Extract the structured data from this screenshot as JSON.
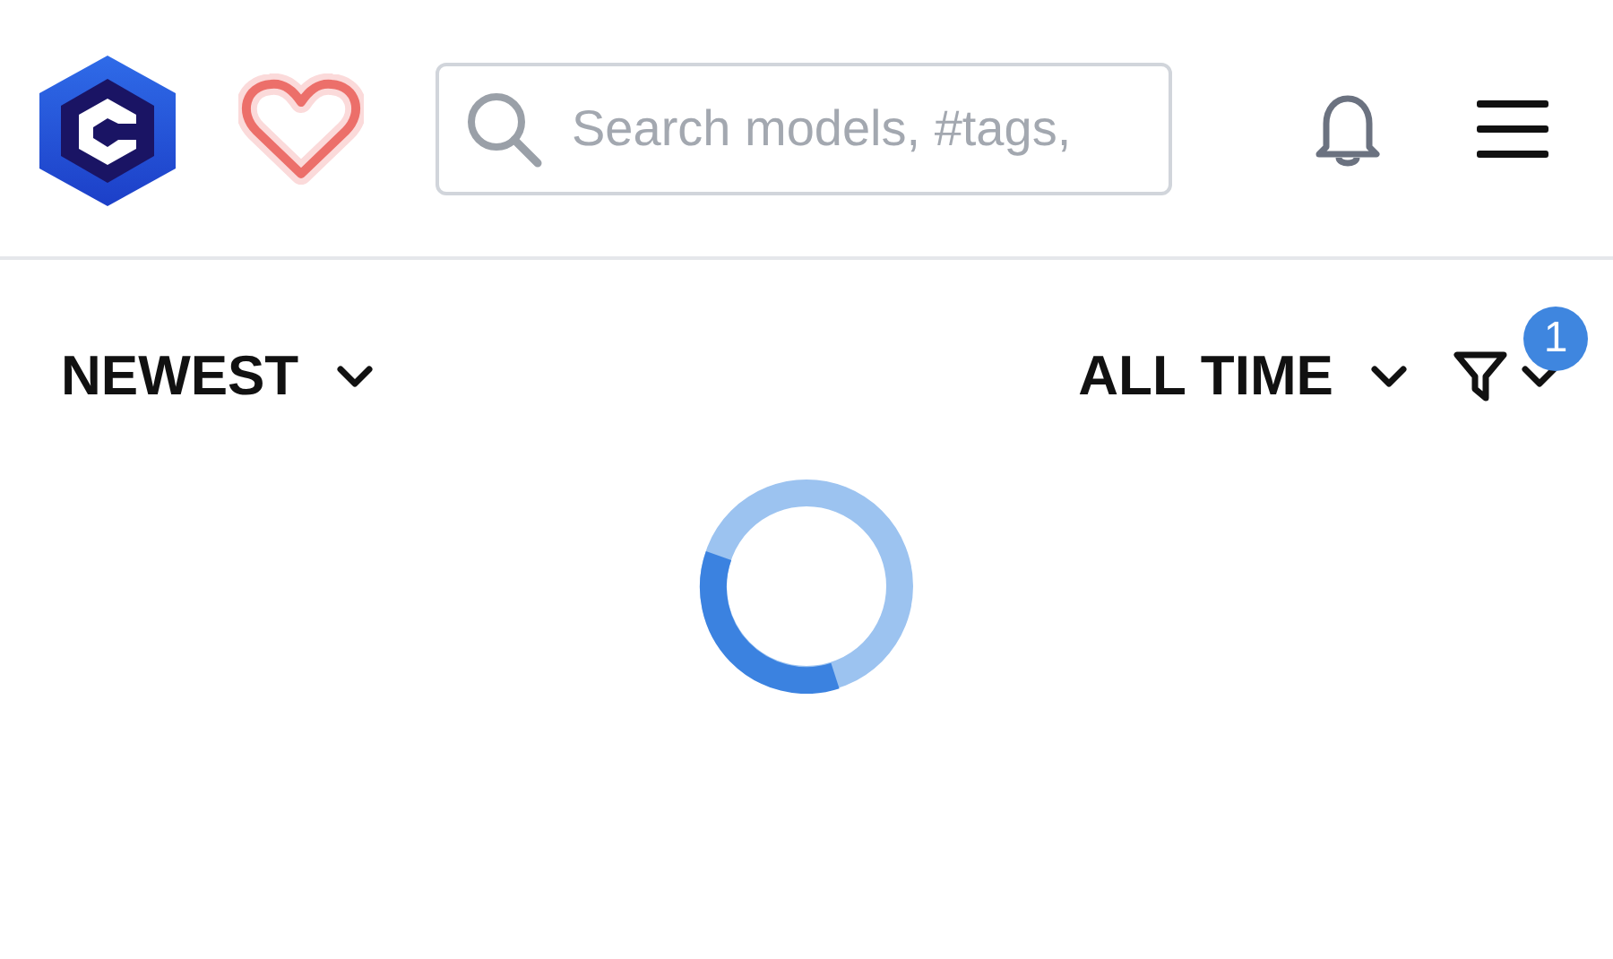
{
  "header": {
    "search": {
      "placeholder": "Search models, #tags,"
    }
  },
  "toolbar": {
    "sort": {
      "label": "NEWEST"
    },
    "period": {
      "label": "ALL TIME"
    },
    "filter": {
      "badge": "1"
    }
  }
}
